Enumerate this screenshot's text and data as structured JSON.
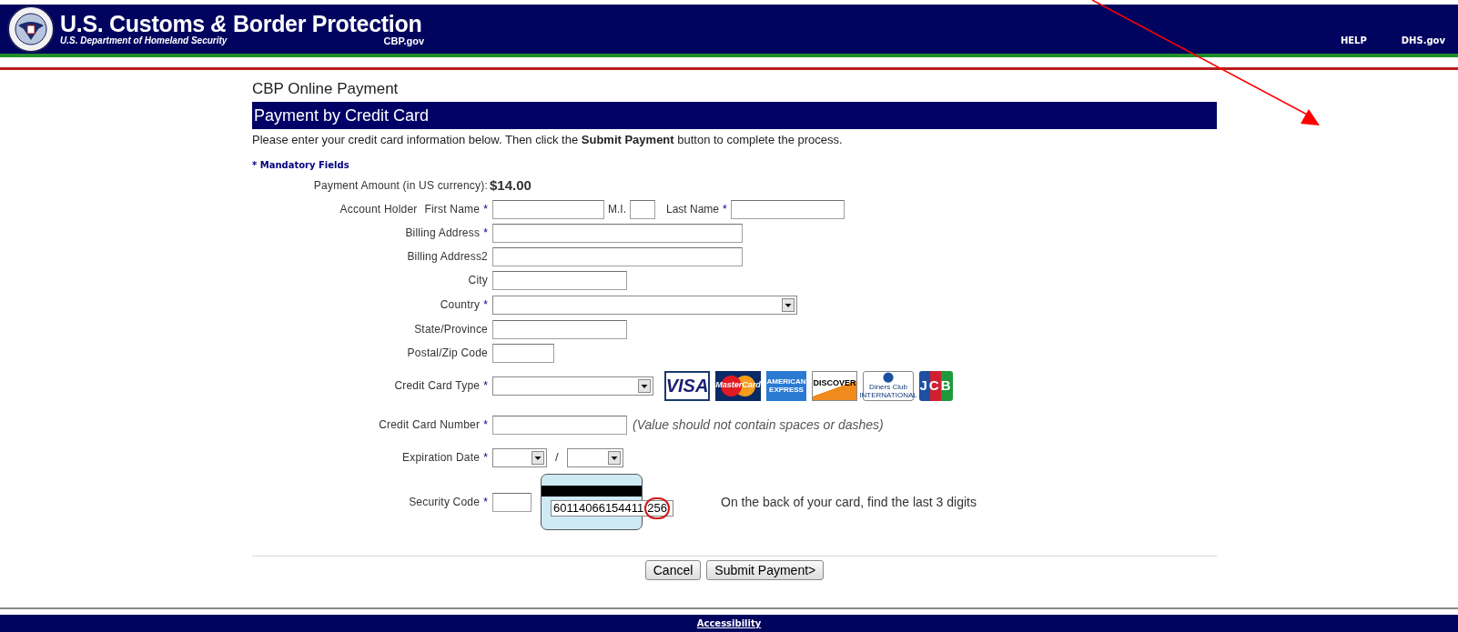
{
  "header": {
    "title": "U.S. Customs *&* Border Protection",
    "subtitle": "U.S. Department of Homeland Security",
    "domain": "CBP.gov",
    "links": [
      "HELP",
      "DHS.gov"
    ]
  },
  "page_title": "CBP Online Payment",
  "section_title": "Payment by Credit Card",
  "instructions": "Please enter your credit card information below. Then click the **Submit Payment** button to complete the process.",
  "mandatory_note": "* Mandatory Fields",
  "form": [
    {
      "kind": "amount",
      "label": "Payment Amount (in US currency):",
      "value": "$14.00"
    },
    {
      "kind": "name",
      "group_label": "Account Holder",
      "label": "First Name",
      "asterisk": "*",
      "mi_label": "M.I.",
      "last_label": "Last Name",
      "last_asterisk": "*"
    },
    {
      "kind": "long_text",
      "label": "Billing Address",
      "asterisk": "*"
    },
    {
      "kind": "long_text",
      "label": "Billing Address2"
    },
    {
      "kind": "text",
      "label": "City"
    },
    {
      "kind": "select",
      "label": "Country",
      "asterisk": "*"
    },
    {
      "kind": "text",
      "label": "State/Province"
    },
    {
      "kind": "short_text",
      "label": "Postal/Zip Code"
    },
    {
      "kind": "card_type",
      "label": "Credit Card Type",
      "asterisk": "*",
      "logos": [
        {
          "kind": "visa",
          "text": "VISA"
        },
        {
          "kind": "mastercard",
          "text": "MasterCard"
        },
        {
          "kind": "amex",
          "text": "AMERICAN EXPRESS"
        },
        {
          "kind": "discover",
          "text": "DISCOVER"
        },
        {
          "kind": "diners",
          "text": "Diners Club INTERNATIONAL"
        },
        {
          "kind": "jcb",
          "text": "JCB"
        }
      ]
    },
    {
      "kind": "card_number",
      "label": "Credit Card Number",
      "asterisk": "*",
      "note": "(Value should not contain spaces or dashes)"
    },
    {
      "kind": "expiration",
      "label": "Expiration Date",
      "asterisk": "*",
      "separator": "/"
    },
    {
      "kind": "security",
      "label": "Security Code",
      "asterisk": "*",
      "card_digits": "60114066154411",
      "card_code": "256",
      "hint": "On the back of your card, find the last 3 digits"
    }
  ],
  "buttons": [
    "Cancel",
    "Submit Payment>"
  ],
  "footer": {
    "link": "Accessibility"
  }
}
